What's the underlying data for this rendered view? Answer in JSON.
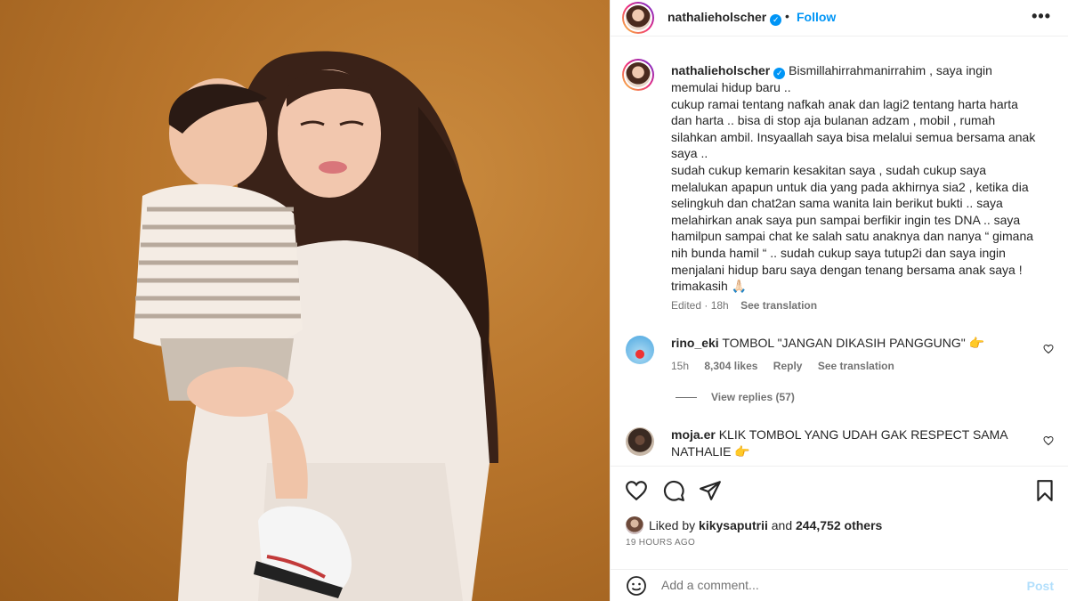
{
  "post": {
    "username": "nathalieholscher",
    "verified_mark": "✓",
    "separator": "•",
    "follow_label": "Follow",
    "more_label": "•••"
  },
  "caption": {
    "username": "nathalieholscher",
    "text": "Bismillahirrahmanirrahim , saya ingin memulai hidup baru ..\ncukup ramai tentang nafkah anak dan lagi2 tentang harta harta dan harta .. bisa di stop aja bulanan adzam , mobil , rumah silahkan ambil. Insyaallah saya bisa melalui semua bersama anak saya ..\nsudah cukup kemarin kesakitan saya , sudah cukup saya melalukan apapun untuk dia yang pada akhirnya sia2 , ketika dia selingkuh dan chat2an sama wanita lain berikut bukti .. saya melahirkan anak saya pun sampai berfikir ingin tes DNA .. saya hamilpun sampai chat ke salah satu anaknya dan nanya “ gimana nih bunda hamil “ .. sudah cukup saya tutup2i dan saya ingin menjalani hidup baru saya dengan tenang bersama anak saya ! trimakasih 🙏🏻",
    "edited": "Edited · 18h",
    "see_translation": "See translation"
  },
  "comments": [
    {
      "username": "rino_eki",
      "text": "TOMBOL \"JANGAN DIKASIH PANGGUNG\" 👉",
      "time": "15h",
      "likes": "8,304 likes",
      "reply": "Reply",
      "see_translation": "See translation",
      "view_replies": "View replies (57)"
    },
    {
      "username": "moja.er",
      "text": "KLIK TOMBOL YANG UDAH GAK RESPECT SAMA NATHALIE 👉"
    }
  ],
  "likes": {
    "prefix": "Liked by ",
    "user": "kikysaputrii",
    "middle": " and ",
    "others": "244,752 others"
  },
  "timestamp": "19 HOURS AGO",
  "composer": {
    "placeholder": "Add a comment...",
    "post_label": "Post"
  },
  "icons": {
    "like": "heart-icon",
    "comment": "comment-icon",
    "share": "send-icon",
    "save": "bookmark-icon",
    "emoji": "emoji-icon"
  },
  "colors": {
    "accent": "#0095f6",
    "post_disabled": "#b2dffc",
    "muted": "#737373",
    "photo_bg": "#b8752c"
  }
}
